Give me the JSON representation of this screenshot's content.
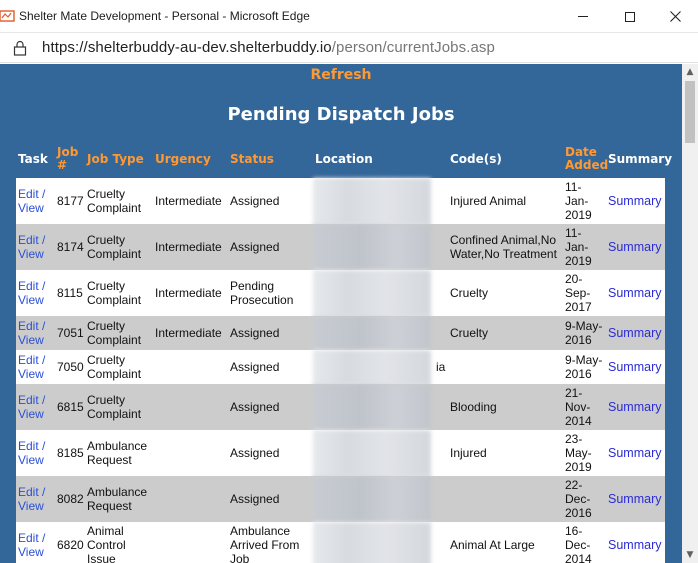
{
  "window": {
    "title": "Shelter Mate Development - Personal - Microsoft Edge"
  },
  "address": {
    "url_host": "https://shelterbuddy-au-dev.shelterbuddy.io",
    "url_path": "/person/currentJobs.asp"
  },
  "page": {
    "refresh_label": "Refresh",
    "title": "Pending Dispatch Jobs"
  },
  "colors": {
    "page_background": "#336699",
    "header_orange": "#ff9933",
    "link_blue": "#2b2bd6",
    "row_alt": "#cccccc"
  },
  "table": {
    "headers": {
      "task": "Task",
      "job_no_1": "Job",
      "job_no_2": "#",
      "job_type": "Job Type",
      "urgency": "Urgency",
      "status": "Status",
      "location": "Location",
      "codes": "Code(s)",
      "date_added_1": "Date",
      "date_added_2": "Added",
      "summary": "Summary"
    },
    "rows": [
      {
        "edit": "Edit /",
        "view": "View",
        "job": "8177",
        "type": [
          "Cruelty",
          "Complaint"
        ],
        "urgency": "Intermediate",
        "status": [
          "Assigned"
        ],
        "location_tail": "",
        "codes": [
          "Injured Animal"
        ],
        "date": [
          "11-",
          "Jan-",
          "2019"
        ],
        "summary": "Summary"
      },
      {
        "edit": "Edit /",
        "view": "View",
        "job": "8174",
        "type": [
          "Cruelty",
          "Complaint"
        ],
        "urgency": "Intermediate",
        "status": [
          "Assigned"
        ],
        "location_tail": "",
        "codes": [
          "Confined Animal,No",
          "Water,No Treatment"
        ],
        "date": [
          "11-",
          "Jan-",
          "2019"
        ],
        "summary": "Summary"
      },
      {
        "edit": "Edit /",
        "view": "View",
        "job": "8115",
        "type": [
          "Cruelty",
          "Complaint"
        ],
        "urgency": "Intermediate",
        "status": [
          "Pending",
          "Prosecution"
        ],
        "location_tail": "",
        "codes": [
          "Cruelty"
        ],
        "date": [
          "20-",
          "Sep-",
          "2017"
        ],
        "summary": "Summary"
      },
      {
        "edit": "Edit /",
        "view": "View",
        "job": "7051",
        "type": [
          "Cruelty",
          "Complaint"
        ],
        "urgency": "Intermediate",
        "status": [
          "Assigned"
        ],
        "location_tail": "",
        "codes": [
          "Cruelty"
        ],
        "date": [
          "9-May-",
          "2016"
        ],
        "summary": "Summary"
      },
      {
        "edit": "Edit /",
        "view": "View",
        "job": "7050",
        "type": [
          "Cruelty",
          "Complaint"
        ],
        "urgency": "",
        "status": [
          "Assigned"
        ],
        "location_tail": "ia",
        "codes": [],
        "date": [
          "9-May-",
          "2016"
        ],
        "summary": "Summary"
      },
      {
        "edit": "Edit /",
        "view": "View",
        "job": "6815",
        "type": [
          "Cruelty",
          "Complaint"
        ],
        "urgency": "",
        "status": [
          "Assigned"
        ],
        "location_tail": "",
        "codes": [
          "Blooding"
        ],
        "date": [
          "21-",
          "Nov-",
          "2014"
        ],
        "summary": "Summary"
      },
      {
        "edit": "Edit /",
        "view": "View",
        "job": "8185",
        "type": [
          "Ambulance",
          "Request"
        ],
        "urgency": "",
        "status": [
          "Assigned"
        ],
        "location_tail": "",
        "codes": [
          "Injured"
        ],
        "date": [
          "23-",
          "May-",
          "2019"
        ],
        "summary": "Summary"
      },
      {
        "edit": "Edit /",
        "view": "View",
        "job": "8082",
        "type": [
          "Ambulance",
          "Request"
        ],
        "urgency": "",
        "status": [
          "Assigned"
        ],
        "location_tail": "",
        "codes": [],
        "date": [
          "22-",
          "Dec-",
          "2016"
        ],
        "summary": "Summary"
      },
      {
        "edit": "Edit /",
        "view": "View",
        "job": "6820",
        "type": [
          "Animal",
          "Control",
          "Issue"
        ],
        "urgency": "",
        "status": [
          "Ambulance",
          "Arrived From",
          "Job"
        ],
        "location_tail": "",
        "codes": [
          "Animal At Large"
        ],
        "date": [
          "16-",
          "Dec-",
          "2014"
        ],
        "summary": "Summary"
      }
    ]
  }
}
